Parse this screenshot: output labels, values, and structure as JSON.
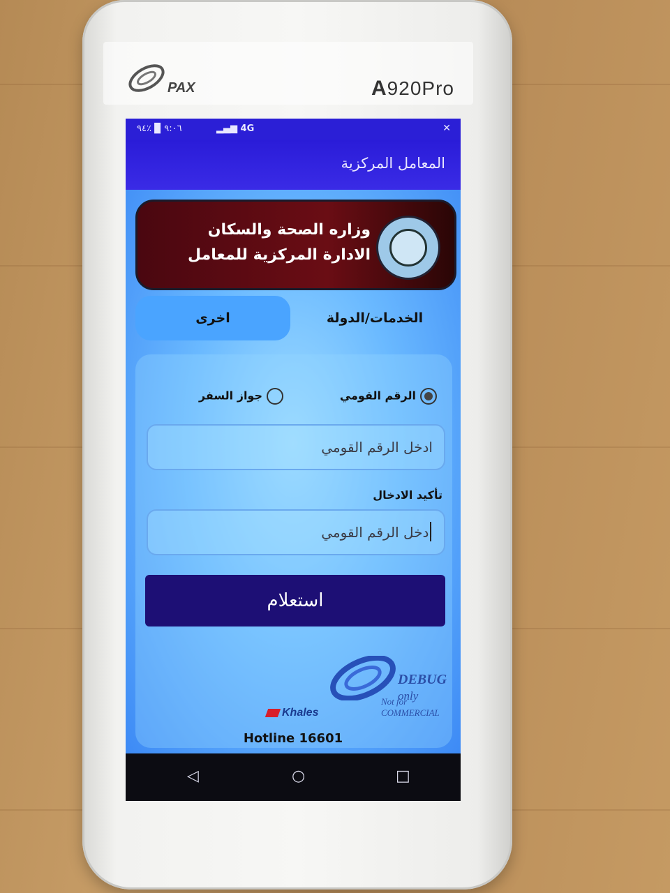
{
  "device": {
    "brand": "PAX",
    "model_prefix": "A",
    "model_rest": "920Pro"
  },
  "status_bar": {
    "left": "٩:٠٦ ▉ ٪٩٤",
    "network": "4G",
    "right_icon": "x-icon"
  },
  "app_bar": {
    "title": "المعامل المركزية"
  },
  "banner": {
    "line1": "وزاره الصحة والسكان",
    "line2": "الادارة المركزية للمعامل",
    "seal_icon": "ministry-seal-icon"
  },
  "tabs": {
    "gov": "الخدمات/الدولة",
    "other": "اخرى"
  },
  "form": {
    "radio_national": "الرقم القومي",
    "radio_passport": "جواز السفر",
    "selected": "national",
    "field1_placeholder": "ادخل الرقم القومي",
    "confirm_label": "تأكيد الادخال",
    "field2_placeholder": "ادخل الرقم القومي",
    "submit_label": "استعلام"
  },
  "footer": {
    "debug_title": "DEBUG",
    "debug_only": "only",
    "debug_sub": "Not for COMMERCIAL",
    "khales": "Khales",
    "hotline": "Hotline 16601"
  },
  "navbar": {
    "back": "◁",
    "home": "○",
    "recent": "□"
  },
  "colors": {
    "app_bar": "#2a1cd8",
    "submit_button": "#1d0f75",
    "banner": "#5a0a12",
    "selected_tab": "#4aa4ff"
  }
}
